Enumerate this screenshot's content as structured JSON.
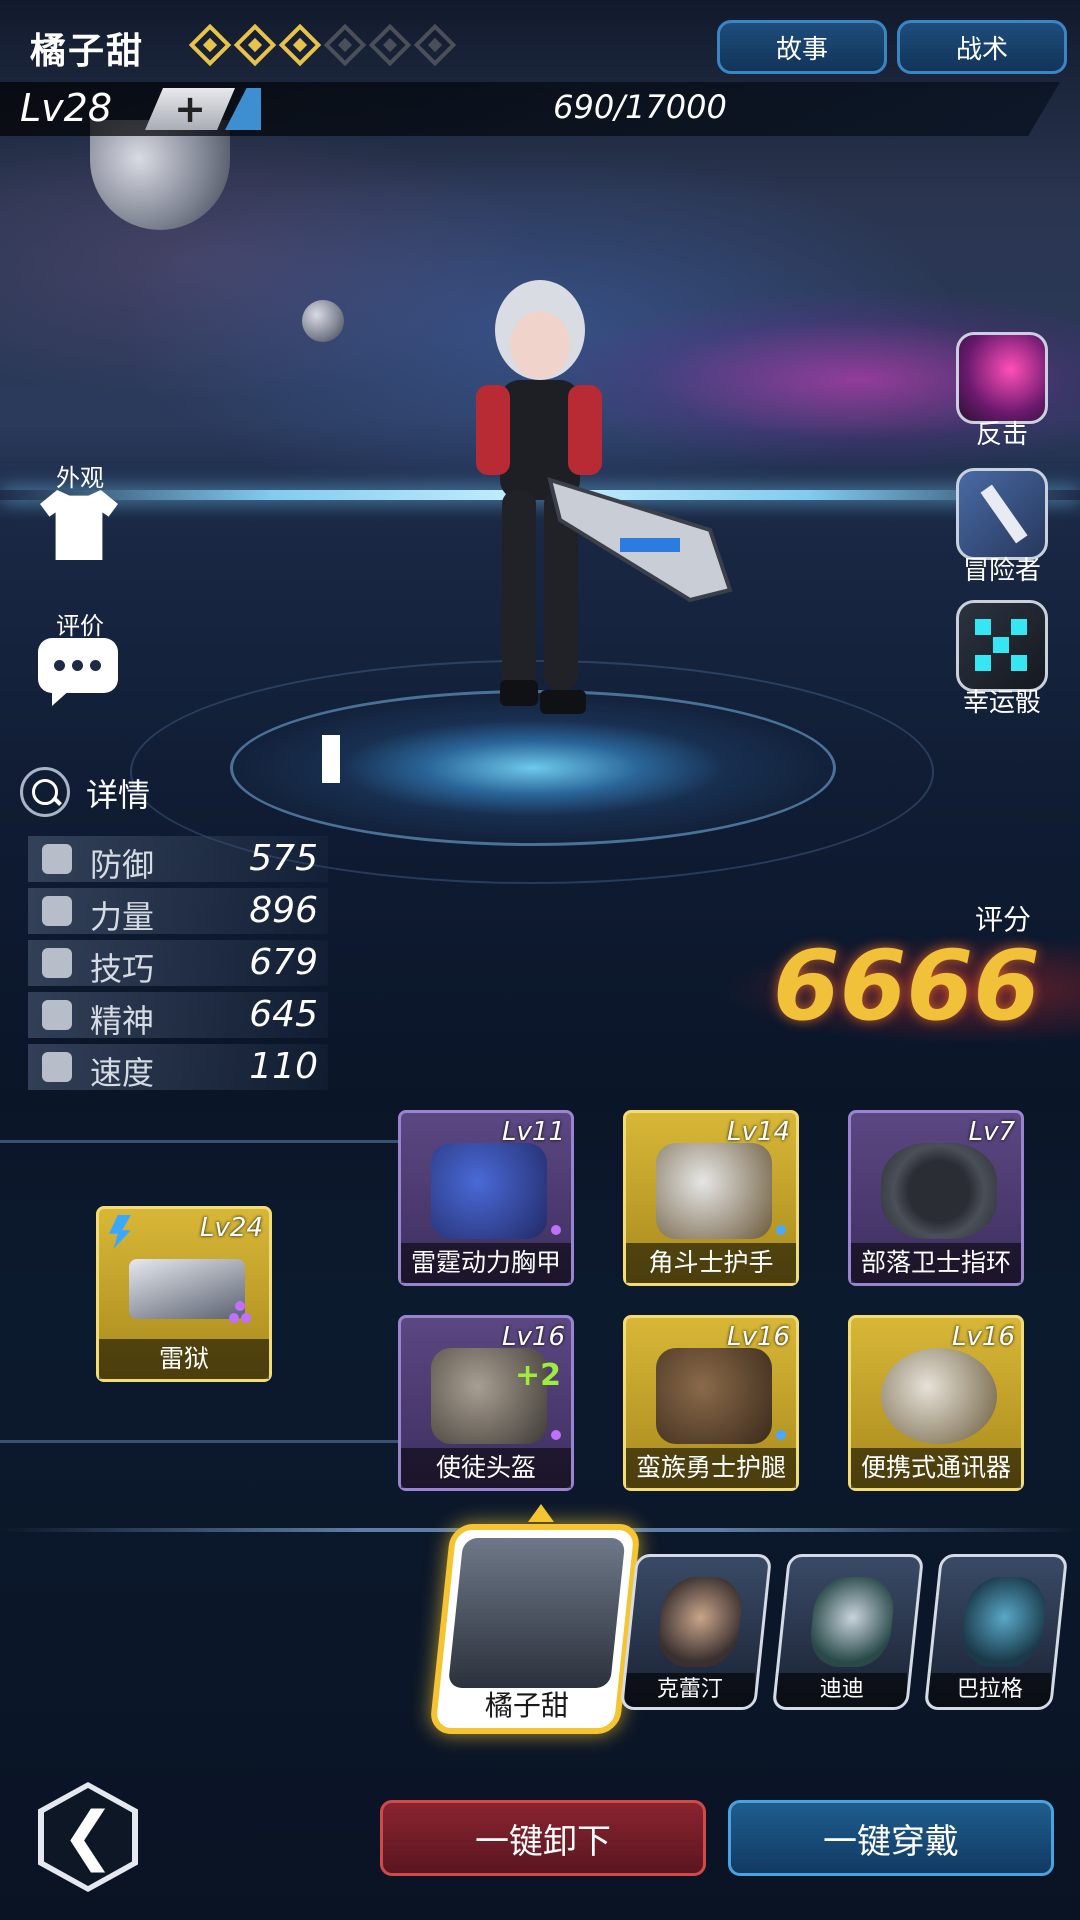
{
  "header": {
    "hero_name": "橘子甜",
    "stars_filled": 3,
    "stars_total": 6,
    "buttons": {
      "story": "故事",
      "tactics": "战术"
    },
    "level": "Lv28",
    "level_up_label": "+",
    "exp": "690/17000"
  },
  "left_menu": {
    "appearance": "外观",
    "review": "评价"
  },
  "stats": {
    "details_label": "详情",
    "rows": [
      {
        "label": "防御",
        "value": "575",
        "icon": "shield-icon"
      },
      {
        "label": "力量",
        "value": "896",
        "icon": "fist-icon"
      },
      {
        "label": "技巧",
        "value": "679",
        "icon": "tools-icon"
      },
      {
        "label": "精神",
        "value": "645",
        "icon": "mind-icon"
      },
      {
        "label": "速度",
        "value": "110",
        "icon": "speed-icon"
      }
    ]
  },
  "score": {
    "label": "评分",
    "value": "6666"
  },
  "skills": [
    {
      "label": "反击",
      "icon": "slash-icon"
    },
    {
      "label": "冒险者",
      "icon": "sword-icon"
    },
    {
      "label": "幸运骰",
      "icon": "dice-icon"
    }
  ],
  "weapon": {
    "level": "Lv24",
    "name": "雷狱",
    "rarity": "gold"
  },
  "equipment": [
    {
      "level": "Lv11",
      "name": "雷霆动力胸甲",
      "rarity": "purple",
      "gem": "#c070ff"
    },
    {
      "level": "Lv14",
      "name": "角斗士护手",
      "rarity": "gold",
      "gem": "#4aa8ff"
    },
    {
      "level": "Lv7",
      "name": "部落卫士指环",
      "rarity": "purple",
      "gem": ""
    },
    {
      "level": "Lv16",
      "name": "使徒头盔",
      "rarity": "purple",
      "gem": "#c070ff",
      "bonus": "+2"
    },
    {
      "level": "Lv16",
      "name": "蛮族勇士护腿",
      "rarity": "gold",
      "gem": "#4aa8ff"
    },
    {
      "level": "Lv16",
      "name": "便携式通讯器",
      "rarity": "gold",
      "gem": ""
    }
  ],
  "heroes": {
    "selected": "橘子甜",
    "others": [
      "克蕾汀",
      "迪迪",
      "巴拉格"
    ]
  },
  "actions": {
    "unequip_all": "一键卸下",
    "equip_all": "一键穿戴"
  },
  "colors": {
    "gold": "#f1c13a",
    "accent_blue": "#3a86c5",
    "danger_red": "#d14a4a"
  }
}
